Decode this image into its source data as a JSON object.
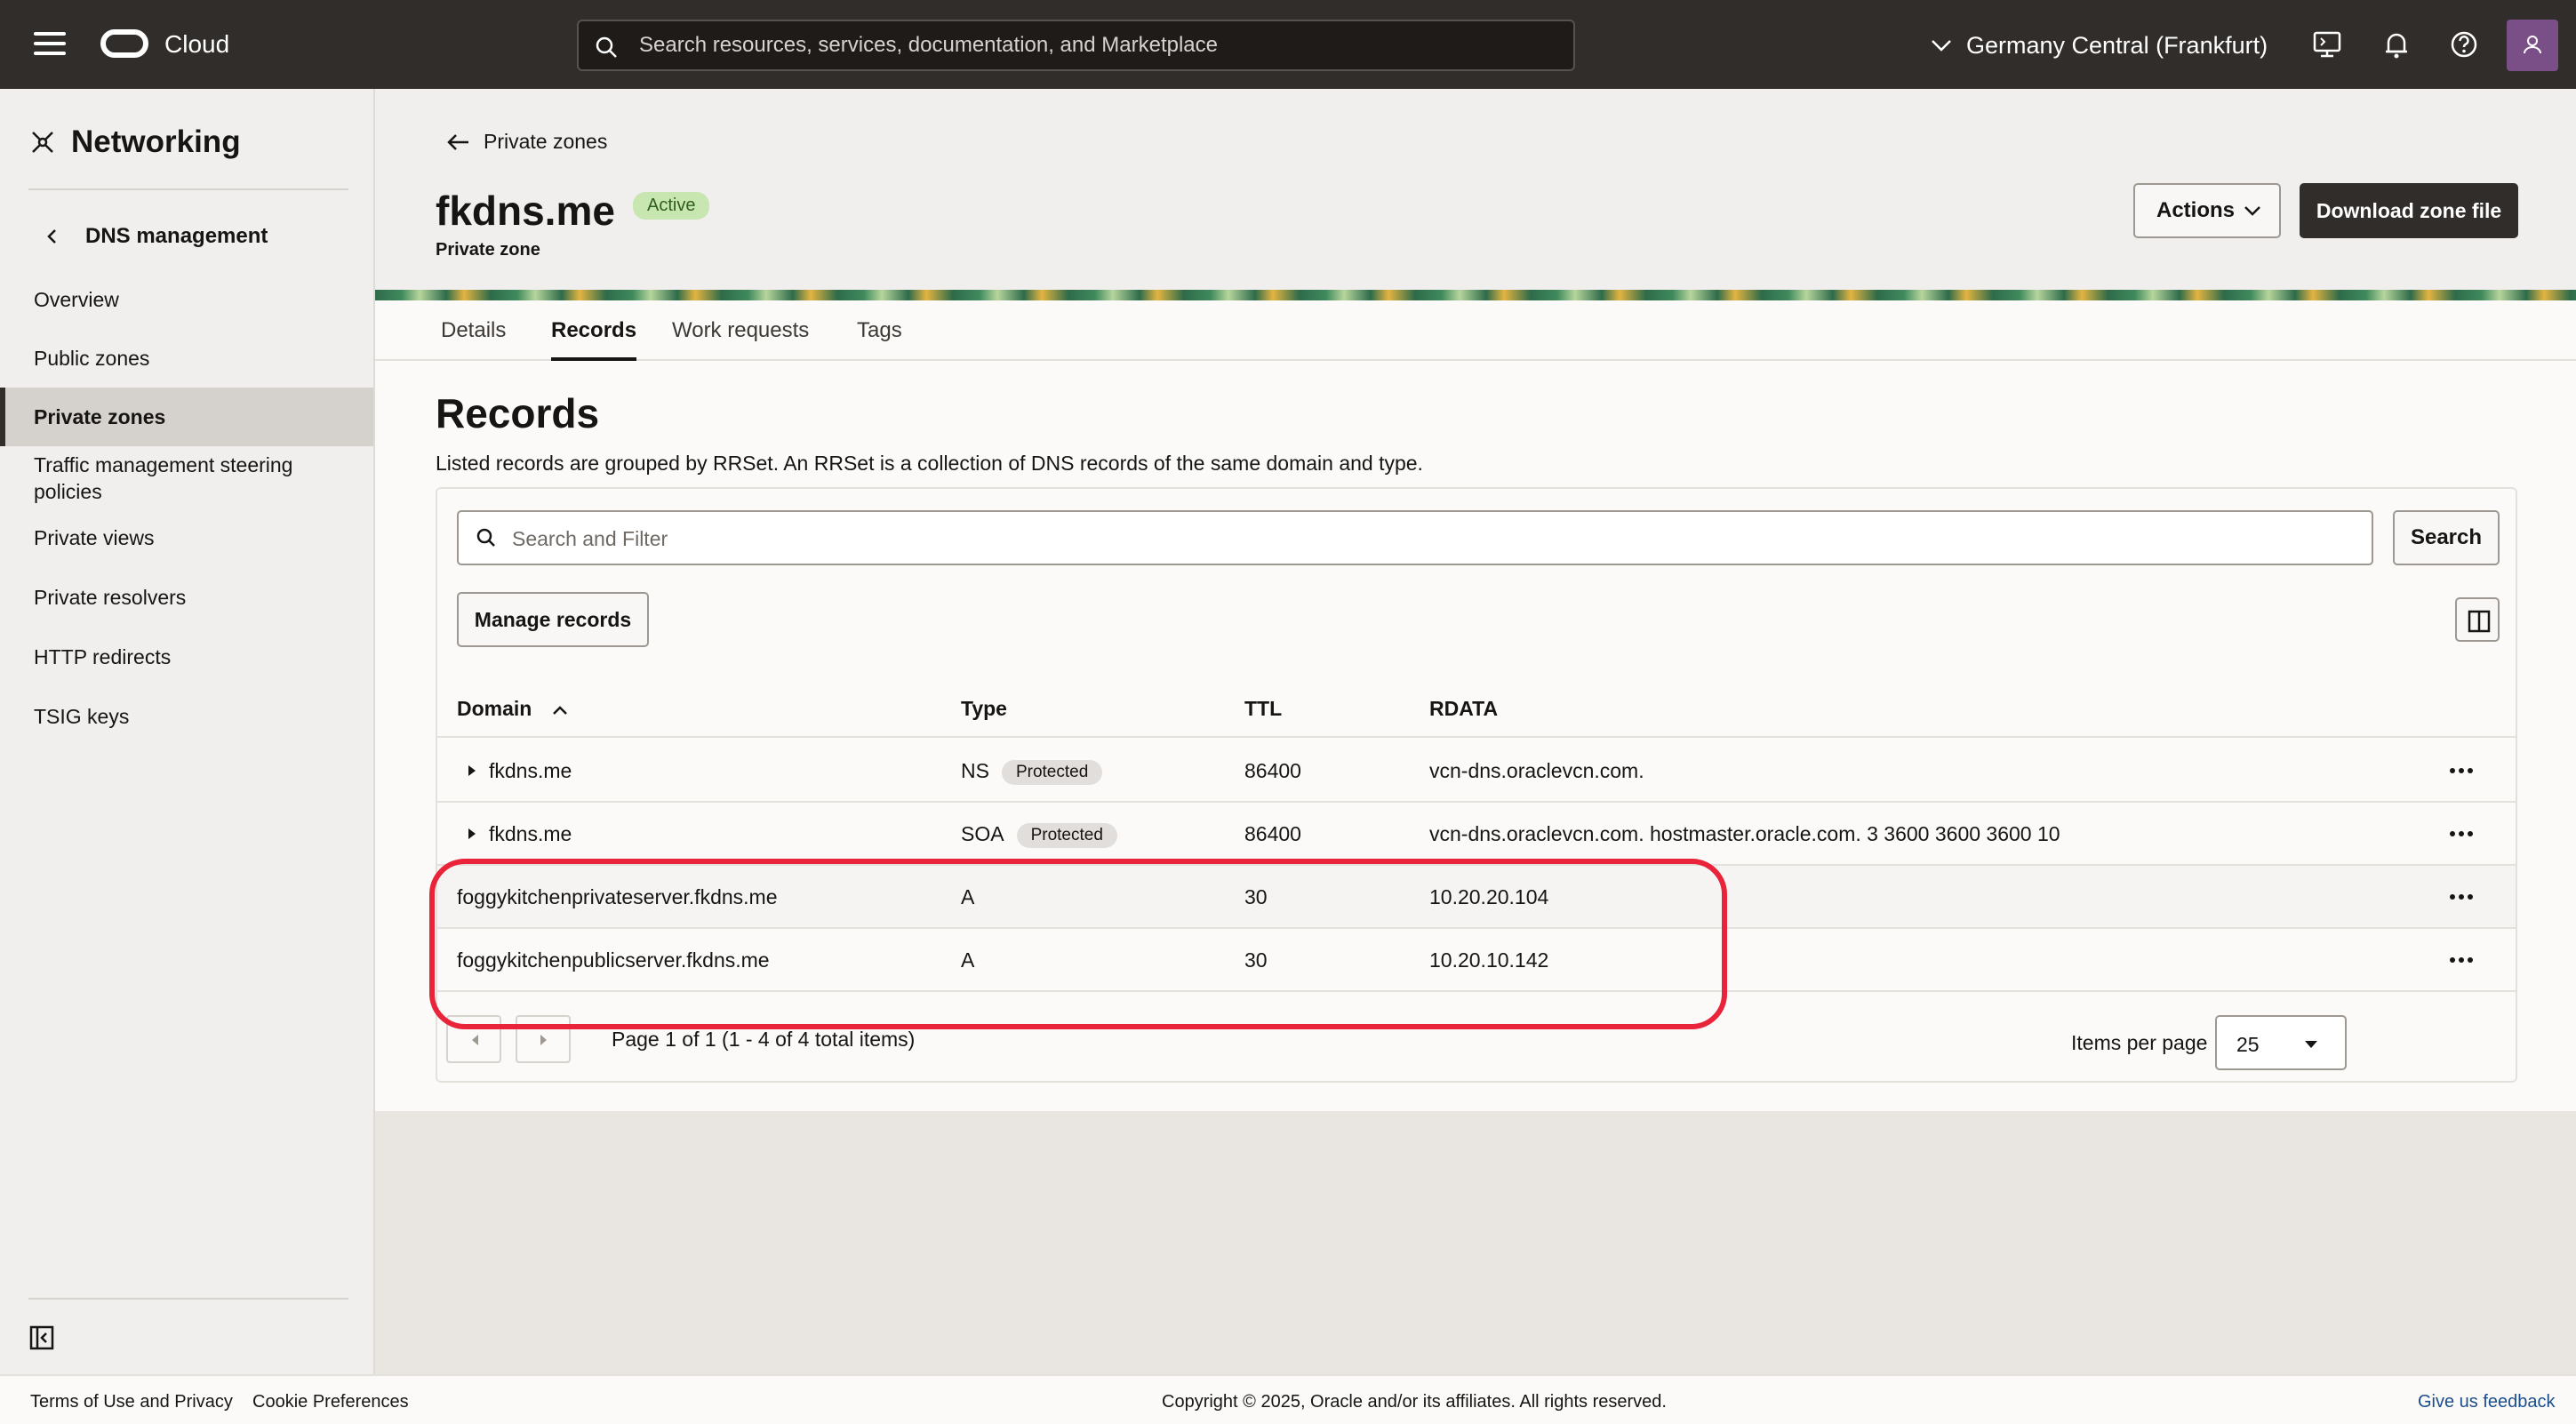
{
  "topbar": {
    "brand": "Cloud",
    "search_placeholder": "Search resources, services, documentation, and Marketplace",
    "region": "Germany Central (Frankfurt)"
  },
  "sidebar": {
    "title": "Networking",
    "back_label": "DNS management",
    "items": [
      {
        "label": "Overview"
      },
      {
        "label": "Public zones"
      },
      {
        "label": "Private zones",
        "active": true
      },
      {
        "label": "Traffic management steering policies"
      },
      {
        "label": "Private views"
      },
      {
        "label": "Private resolvers"
      },
      {
        "label": "HTTP redirects"
      },
      {
        "label": "TSIG keys"
      }
    ]
  },
  "header": {
    "breadcrumb": "Private zones",
    "title": "fkdns.me",
    "status": "Active",
    "subtitle": "Private zone",
    "actions_label": "Actions",
    "download_label": "Download zone file"
  },
  "tabs": [
    {
      "label": "Details"
    },
    {
      "label": "Records",
      "active": true
    },
    {
      "label": "Work requests"
    },
    {
      "label": "Tags"
    }
  ],
  "records": {
    "title": "Records",
    "description": "Listed records are grouped by RRSet. An RRSet is a collection of DNS records of the same domain and type.",
    "filter_placeholder": "Search and Filter",
    "search_label": "Search",
    "manage_label": "Manage records",
    "columns": [
      "Domain",
      "Type",
      "TTL",
      "RDATA"
    ],
    "rows": [
      {
        "domain": "fkdns.me",
        "type": "NS",
        "protected": "Protected",
        "ttl": "86400",
        "rdata": "vcn-dns.oraclevcn.com."
      },
      {
        "domain": "fkdns.me",
        "type": "SOA",
        "protected": "Protected",
        "ttl": "86400",
        "rdata": "vcn-dns.oraclevcn.com. hostmaster.oracle.com. 3 3600 3600 3600 10"
      },
      {
        "domain": "foggykitchenprivateserver.fkdns.me",
        "type": "A",
        "protected": "",
        "ttl": "30",
        "rdata": "10.20.20.104"
      },
      {
        "domain": "foggykitchenpublicserver.fkdns.me",
        "type": "A",
        "protected": "",
        "ttl": "30",
        "rdata": "10.20.10.142"
      }
    ],
    "pagination": "Page 1 of 1 (1 - 4 of 4 total items)",
    "items_per_page_label": "Items per page",
    "items_per_page": "25"
  },
  "footer": {
    "terms": "Terms of Use and Privacy",
    "cookies": "Cookie Preferences",
    "copyright": "Copyright © 2025, Oracle and/or its affiliates. All rights reserved.",
    "feedback": "Give us feedback"
  },
  "colors": {
    "topbar": "#312d2a",
    "highlight": "#e8233a",
    "active_badge": "#c7e6b0"
  }
}
